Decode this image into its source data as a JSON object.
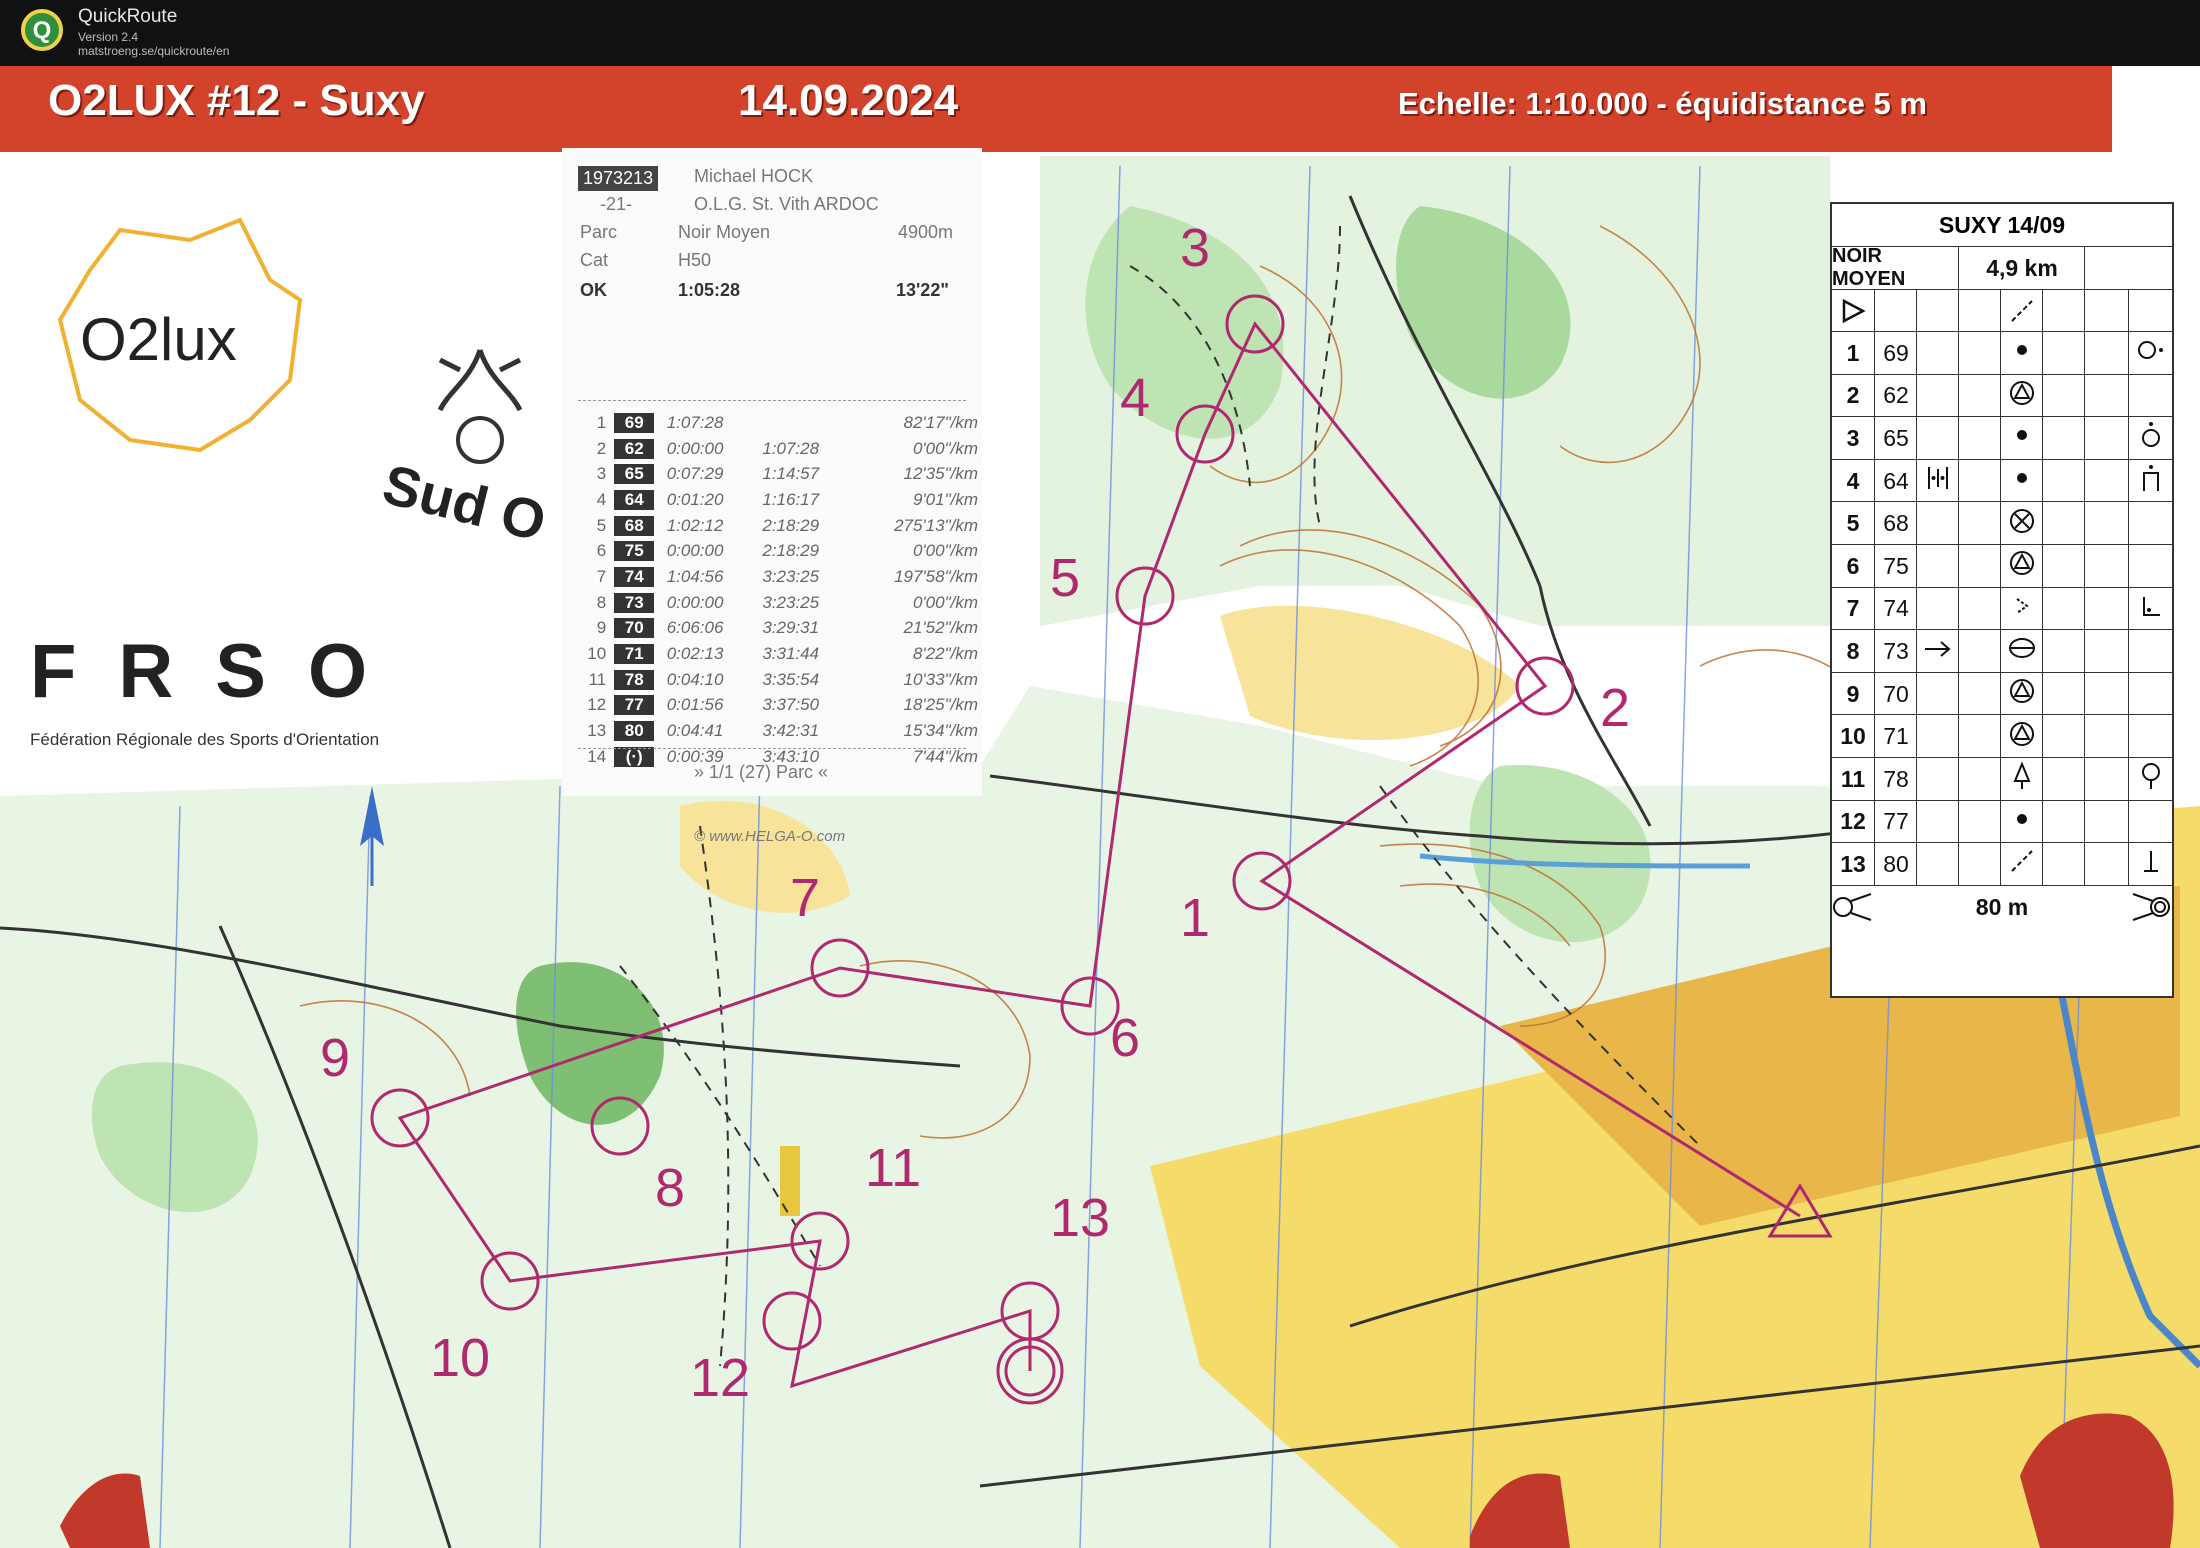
{
  "app": {
    "name": "QuickRoute",
    "version": "Version 2.4",
    "url": "matstroeng.se/quickroute/en"
  },
  "banner": {
    "title": "O2LUX #12 - Suxy",
    "date": "14.09.2024",
    "scale": "Echelle: 1:10.000 - équidistance 5 m"
  },
  "logos": {
    "o2lux": "O2lux",
    "sud": "Sud O",
    "frso": "FRSO",
    "frso_full": "Fédération Régionale des Sports d'Orientation"
  },
  "split": {
    "bib": "1973213",
    "name": "Michael HOCK",
    "age_code": "-21-",
    "club": "O.L.G. St. Vith ARDOC",
    "course_label": "Parc",
    "course": "Noir Moyen",
    "length": "4900m",
    "cat_label": "Cat",
    "category": "H50",
    "status": "OK",
    "time": "1:05:28",
    "pace": "13'22\"",
    "footer": "» 1/1 (27) Parc «",
    "credit": "© www.HELGA-O.com",
    "legs": [
      {
        "n": "1",
        "code": "69",
        "leg": "1:07:28",
        "cum": "",
        "pace": "82'17\"/km"
      },
      {
        "n": "2",
        "code": "62",
        "leg": "0:00:00",
        "cum": "1:07:28",
        "pace": "0'00\"/km"
      },
      {
        "n": "3",
        "code": "65",
        "leg": "0:07:29",
        "cum": "1:14:57",
        "pace": "12'35\"/km"
      },
      {
        "n": "4",
        "code": "64",
        "leg": "0:01:20",
        "cum": "1:16:17",
        "pace": "9'01\"/km"
      },
      {
        "n": "5",
        "code": "68",
        "leg": "1:02:12",
        "cum": "2:18:29",
        "pace": "275'13\"/km"
      },
      {
        "n": "6",
        "code": "75",
        "leg": "0:00:00",
        "cum": "2:18:29",
        "pace": "0'00\"/km"
      },
      {
        "n": "7",
        "code": "74",
        "leg": "1:04:56",
        "cum": "3:23:25",
        "pace": "197'58\"/km"
      },
      {
        "n": "8",
        "code": "73",
        "leg": "0:00:00",
        "cum": "3:23:25",
        "pace": "0'00\"/km"
      },
      {
        "n": "9",
        "code": "70",
        "leg": "6:06:06",
        "cum": "3:29:31",
        "pace": "21'52\"/km"
      },
      {
        "n": "10",
        "code": "71",
        "leg": "0:02:13",
        "cum": "3:31:44",
        "pace": "8'22\"/km"
      },
      {
        "n": "11",
        "code": "78",
        "leg": "0:04:10",
        "cum": "3:35:54",
        "pace": "10'33\"/km"
      },
      {
        "n": "12",
        "code": "77",
        "leg": "0:01:56",
        "cum": "3:37:50",
        "pace": "18'25\"/km"
      },
      {
        "n": "13",
        "code": "80",
        "leg": "0:04:41",
        "cum": "3:42:31",
        "pace": "15'34\"/km"
      },
      {
        "n": "14",
        "code": "(·)",
        "leg": "0:00:39",
        "cum": "3:43:10",
        "pace": "7'44\"/km"
      }
    ]
  },
  "description": {
    "event": "SUXY 14/09",
    "course": "NOIR MOYEN",
    "length": "4,9 km",
    "finish_distance": "80 m",
    "controls": [
      {
        "n": "1",
        "code": "69"
      },
      {
        "n": "2",
        "code": "62"
      },
      {
        "n": "3",
        "code": "65"
      },
      {
        "n": "4",
        "code": "64"
      },
      {
        "n": "5",
        "code": "68"
      },
      {
        "n": "6",
        "code": "75"
      },
      {
        "n": "7",
        "code": "74"
      },
      {
        "n": "8",
        "code": "73"
      },
      {
        "n": "9",
        "code": "70"
      },
      {
        "n": "10",
        "code": "71"
      },
      {
        "n": "11",
        "code": "78"
      },
      {
        "n": "12",
        "code": "77"
      },
      {
        "n": "13",
        "code": "80"
      }
    ]
  },
  "course_map": {
    "control_numbers": [
      "1",
      "2",
      "3",
      "4",
      "5",
      "6",
      "7",
      "8",
      "9",
      "10",
      "11",
      "12",
      "13"
    ],
    "course_color": "#b0286e"
  }
}
